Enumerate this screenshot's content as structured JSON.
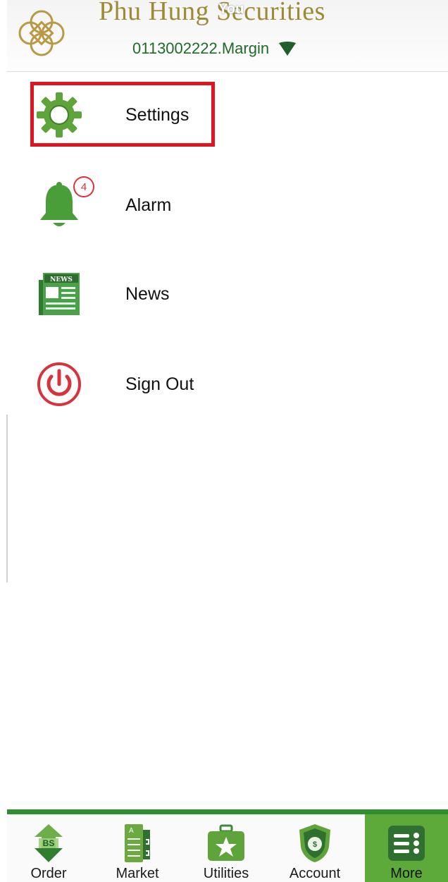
{
  "header": {
    "brand": "Phu Hung Securities",
    "watermark": "You",
    "account": "0113002222.Margin"
  },
  "menu": {
    "items": [
      {
        "label": "Settings",
        "icon": "gear-icon",
        "highlighted": true
      },
      {
        "label": "Alarm",
        "icon": "bell-icon",
        "badge": "4"
      },
      {
        "label": "News",
        "icon": "newspaper-icon",
        "icon_text": "NEWS"
      },
      {
        "label": "Sign Out",
        "icon": "power-icon"
      }
    ]
  },
  "bottom_nav": {
    "tabs": [
      {
        "label": "Order",
        "icon": "order-icon",
        "icon_text": "BS"
      },
      {
        "label": "Market",
        "icon": "market-icon",
        "icon_text": "A"
      },
      {
        "label": "Utilities",
        "icon": "utilities-icon"
      },
      {
        "label": "Account",
        "icon": "account-icon"
      },
      {
        "label": "More",
        "icon": "more-icon",
        "active": true
      }
    ]
  },
  "colors": {
    "brand_gold": "#9d8a35",
    "green": "#2f8f2f",
    "active_tab": "#5daa3a",
    "highlight_red": "#e0141e"
  }
}
